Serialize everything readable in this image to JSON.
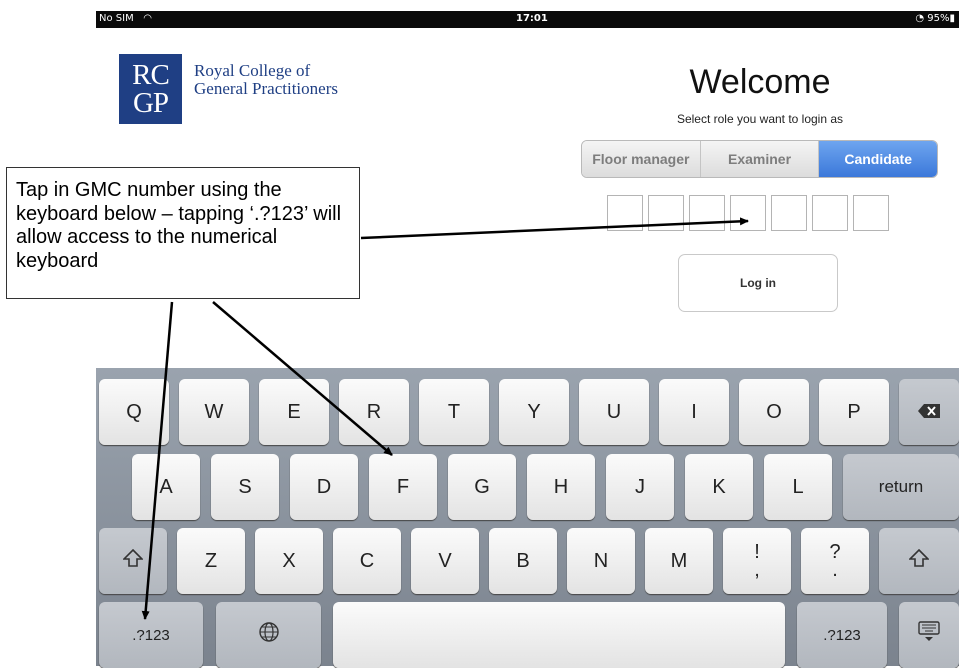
{
  "status_bar": {
    "carrier": "No SIM",
    "wifi_icon": "wifi-icon",
    "time": "17:01",
    "battery": "95%",
    "battery_icon": "battery-icon",
    "lock_icon": "rotation-lock-icon"
  },
  "logo": {
    "initials_top": "RC",
    "initials_bottom": "GP",
    "name_line1": "Royal College of",
    "name_line2": "General Practitioners",
    "brand_color": "#1f3f84"
  },
  "login": {
    "title": "Welcome",
    "subtitle": "Select role you want to login as",
    "roles": [
      "Floor manager",
      "Examiner",
      "Candidate"
    ],
    "selected_role": "Candidate",
    "accent_color": "#3b78da",
    "button_label": "Log in"
  },
  "callout": {
    "text": "Tap in GMC number using the keyboard below – tapping ‘.?123’ will allow access to the numerical keyboard"
  },
  "keyboard": {
    "row1": [
      "Q",
      "W",
      "E",
      "R",
      "T",
      "Y",
      "U",
      "I",
      "O",
      "P"
    ],
    "row2": [
      "A",
      "S",
      "D",
      "F",
      "G",
      "H",
      "J",
      "K",
      "L"
    ],
    "row3": [
      "Z",
      "X",
      "C",
      "V",
      "B",
      "N",
      "M"
    ],
    "return_label": "return",
    "num_label": ".?123",
    "punct1_top": "!",
    "punct1_bottom": ",",
    "punct2_top": "?",
    "punct2_bottom": ".",
    "backspace_icon": "backspace-icon",
    "shift_icon": "shift-icon",
    "globe_icon": "globe-icon",
    "hide_keyboard_icon": "hide-keyboard-icon"
  }
}
